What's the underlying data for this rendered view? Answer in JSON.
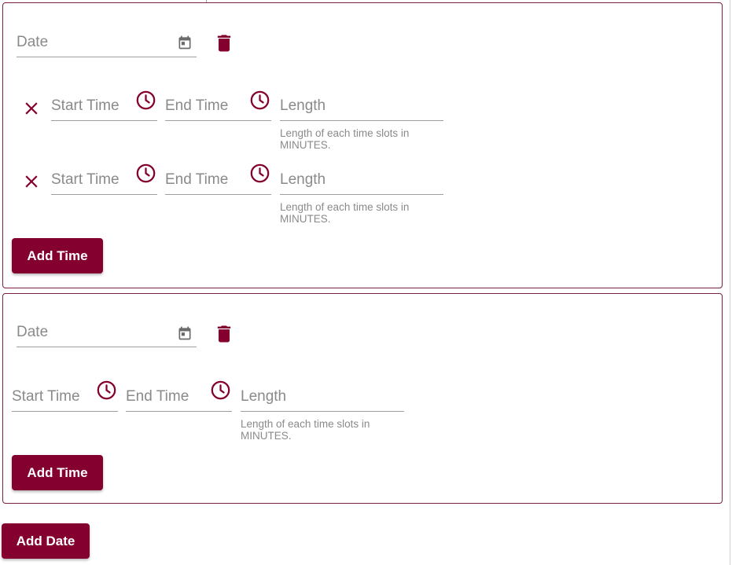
{
  "colors": {
    "accent": "#84002f",
    "card_border": "#7a1f45",
    "placeholder": "#8a8a8a"
  },
  "date_groups": [
    {
      "date_placeholder": "Date",
      "date_icon": "calendar-icon",
      "delete_icon": "trash-icon",
      "time_rows": [
        {
          "remove_icon": "close-icon",
          "start_placeholder": "Start Time",
          "end_placeholder": "End Time",
          "length_placeholder": "Length",
          "length_hint": "Length of each time slots in MINUTES.",
          "clock_icon": "clock-icon"
        },
        {
          "remove_icon": "close-icon",
          "start_placeholder": "Start Time",
          "end_placeholder": "End Time",
          "length_placeholder": "Length",
          "length_hint": "Length of each time slots in MINUTES.",
          "clock_icon": "clock-icon"
        }
      ],
      "add_time_label": "Add Time"
    },
    {
      "date_placeholder": "Date",
      "date_icon": "calendar-icon",
      "delete_icon": "trash-icon",
      "time_rows": [
        {
          "start_placeholder": "Start Time",
          "end_placeholder": "End Time",
          "length_placeholder": "Length",
          "length_hint": "Length of each time slots in MINUTES.",
          "clock_icon": "clock-icon"
        }
      ],
      "add_time_label": "Add Time"
    }
  ],
  "add_date_label": "Add Date"
}
